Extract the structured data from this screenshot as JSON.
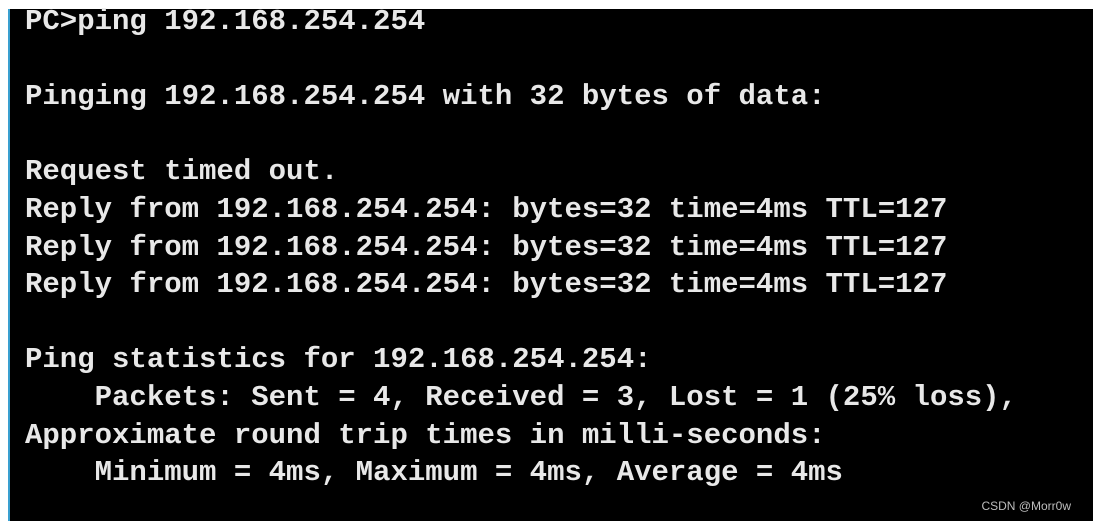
{
  "terminal": {
    "lines": [
      "PC>ping 192.168.254.254",
      "",
      "Pinging 192.168.254.254 with 32 bytes of data:",
      "",
      "Request timed out.",
      "Reply from 192.168.254.254: bytes=32 time=4ms TTL=127",
      "Reply from 192.168.254.254: bytes=32 time=4ms TTL=127",
      "Reply from 192.168.254.254: bytes=32 time=4ms TTL=127",
      "",
      "Ping statistics for 192.168.254.254:",
      "    Packets: Sent = 4, Received = 3, Lost = 1 (25% loss),",
      "Approximate round trip times in milli-seconds:",
      "    Minimum = 4ms, Maximum = 4ms, Average = 4ms"
    ]
  },
  "watermark": "CSDN @Morr0w",
  "colors": {
    "background": "#000000",
    "text": "#e8e8e8",
    "border": "#3aa0d0"
  }
}
